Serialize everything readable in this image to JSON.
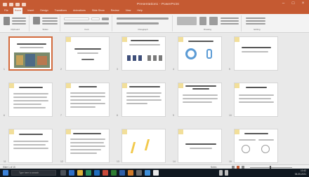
{
  "window": {
    "title": "Presentation1 - PowerPoint",
    "controls": {
      "minimize": "–",
      "maximize": "□",
      "close": "×"
    }
  },
  "ribbon": {
    "tabs": [
      "File",
      "Home",
      "Insert",
      "Design",
      "Transitions",
      "Animations",
      "Slide Show",
      "Review",
      "View",
      "Help"
    ],
    "active_tab": "Home",
    "groups": [
      "Clipboard",
      "Slides",
      "Font",
      "Paragraph",
      "Drawing",
      "Editing"
    ]
  },
  "slides": [
    {
      "number": "1"
    },
    {
      "number": "2"
    },
    {
      "number": "3"
    },
    {
      "number": "4"
    },
    {
      "number": "5"
    },
    {
      "number": "6"
    },
    {
      "number": "7"
    },
    {
      "number": "8"
    },
    {
      "number": "9"
    },
    {
      "number": "10"
    },
    {
      "number": "11"
    },
    {
      "number": "12"
    },
    {
      "number": "13"
    },
    {
      "number": "14"
    },
    {
      "number": "15"
    }
  ],
  "status": {
    "left": "Slide 1 of 15",
    "right": "Notes"
  },
  "taskbar": {
    "search_placeholder": "Type here to search",
    "time": "10:42",
    "date": "06-05-2021"
  },
  "colors": {
    "accent": "#c55a32",
    "selection": "#d36a3c",
    "taskbar": "#101820"
  }
}
